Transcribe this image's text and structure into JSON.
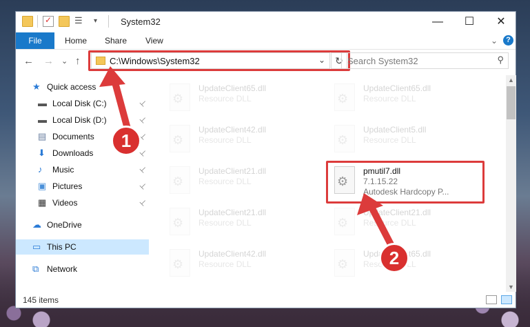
{
  "window": {
    "title": "System32",
    "controls": {
      "minimize": "—",
      "maximize": "☐",
      "close": "✕"
    }
  },
  "ribbon": {
    "file_tab": "File",
    "tabs": [
      "Home",
      "Share",
      "View"
    ],
    "help": "?",
    "expand": "⌄"
  },
  "navigation": {
    "back": "←",
    "forward": "→",
    "recent": "⌄",
    "up": "↑",
    "address": "C:\\Windows\\System32",
    "address_dropdown": "⌄",
    "refresh": "↻",
    "search_placeholder": "Search System32",
    "search_icon": "⚲"
  },
  "sidebar": {
    "items": [
      {
        "label": "Quick access",
        "icon": "star-icon",
        "pinned": false
      },
      {
        "label": "Local Disk (C:)",
        "icon": "drive-icon",
        "pinned": true
      },
      {
        "label": "Local Disk (D:)",
        "icon": "drive-icon",
        "pinned": true
      },
      {
        "label": "Documents",
        "icon": "documents-icon",
        "pinned": true
      },
      {
        "label": "Downloads",
        "icon": "download-icon",
        "pinned": true
      },
      {
        "label": "Music",
        "icon": "music-icon",
        "pinned": true
      },
      {
        "label": "Pictures",
        "icon": "pictures-icon",
        "pinned": true
      },
      {
        "label": "Videos",
        "icon": "videos-icon",
        "pinned": true
      },
      {
        "label": "OneDrive",
        "icon": "onedrive-icon",
        "pinned": false
      },
      {
        "label": "This PC",
        "icon": "computer-icon",
        "pinned": false,
        "selected": true
      },
      {
        "label": "Network",
        "icon": "network-icon",
        "pinned": false
      }
    ],
    "pin_glyph": "📌"
  },
  "files": [
    {
      "name": "UpdateClient65.dll",
      "line1": "Resource DLL",
      "line2": "",
      "faded": true
    },
    {
      "name": "UpdateClient65.dll",
      "line1": "Resource DLL",
      "line2": "",
      "faded": true
    },
    {
      "name": "UpdateClient42.dll",
      "line1": "Resource DLL",
      "line2": "",
      "faded": true
    },
    {
      "name": "UpdateClient5.dll",
      "line1": "Resource DLL",
      "line2": "",
      "faded": true
    },
    {
      "name": "UpdateClient21.dll",
      "line1": "Resource DLL",
      "line2": "",
      "faded": true
    },
    {
      "name": "pmutil7.dll",
      "line1": "7.1.15.22",
      "line2": "Autodesk Hardcopy P...",
      "faded": false
    },
    {
      "name": "UpdateClient21.dll",
      "line1": "Resource DLL",
      "line2": "",
      "faded": true
    },
    {
      "name": "UpdateClient21.dll",
      "line1": "Resource DLL",
      "line2": "",
      "faded": true
    },
    {
      "name": "UpdateClient42.dll",
      "line1": "Resource DLL",
      "line2": "",
      "faded": true
    },
    {
      "name": "UpdateClient65.dll",
      "line1": "Resource DLL",
      "line2": "",
      "faded": true
    }
  ],
  "status": {
    "item_count": "145 items"
  },
  "annotations": {
    "badge1": "1",
    "badge2": "2",
    "accent": "#dc3b3b"
  }
}
